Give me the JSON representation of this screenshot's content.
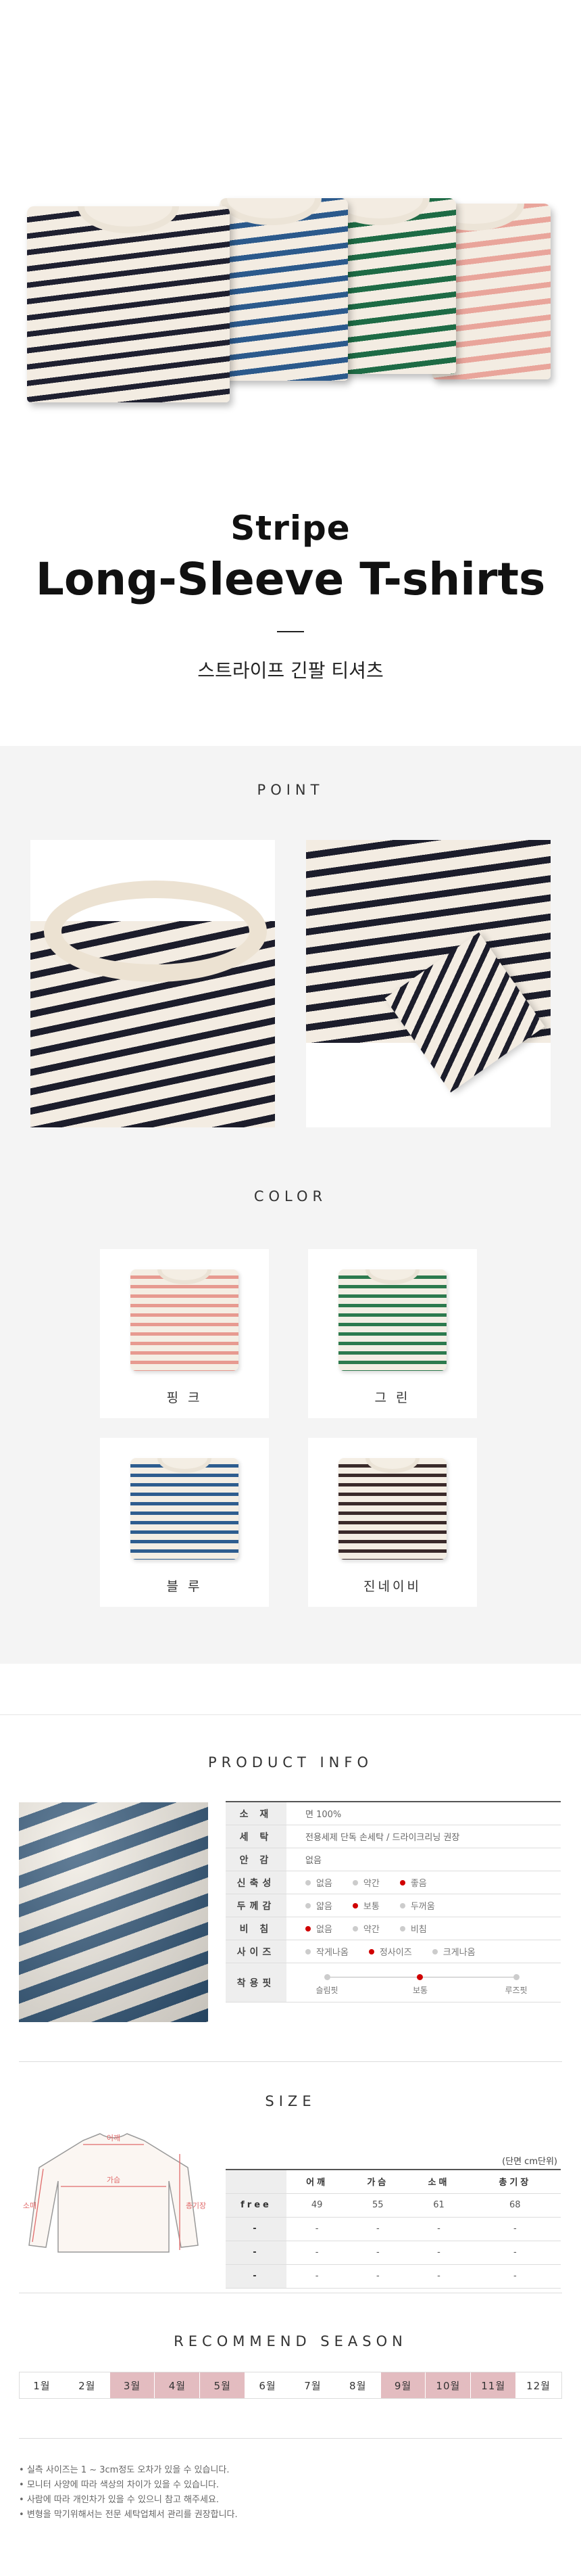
{
  "hero": {
    "title_line1": "Stripe",
    "title_line2": "Long-Sleeve T-shirts",
    "subtitle_ko": "스트라이프 긴팔 티셔츠",
    "shirt_colors": [
      "#1f2030",
      "#2c5a8c",
      "#1e6b45",
      "#e9a59b"
    ]
  },
  "point": {
    "title": "POINT"
  },
  "color": {
    "title": "COLOR",
    "items": [
      {
        "label": "핑 크",
        "stripe": "#e79a90"
      },
      {
        "label": "그 린",
        "stripe": "#2d7a4e"
      },
      {
        "label": "블 루",
        "stripe": "#2e5d8f"
      },
      {
        "label": "진네이비",
        "stripe": "#3a2a2a"
      }
    ]
  },
  "product_info": {
    "title": "PRODUCT INFO",
    "rows": [
      {
        "key": "소 재",
        "value": "면 100%"
      },
      {
        "key": "세 탁",
        "value": "전용세제 단독 손세탁 / 드라이크리닝 권장"
      },
      {
        "key": "안 감",
        "value": "없음"
      },
      {
        "key": "신축성",
        "options": [
          "없음",
          "약간",
          "좋음"
        ],
        "selected": 2
      },
      {
        "key": "두께감",
        "options": [
          "얇음",
          "보통",
          "두꺼움"
        ],
        "selected": 1
      },
      {
        "key": "비 침",
        "options": [
          "없음",
          "약간",
          "비침"
        ],
        "selected": 0
      },
      {
        "key": "사이즈",
        "options": [
          "작게나옴",
          "정사이즈",
          "크게나옴"
        ],
        "selected": 1
      },
      {
        "key": "착용핏",
        "fit": [
          "슬림핏",
          "보통",
          "루즈핏"
        ],
        "selected": 1
      }
    ]
  },
  "size": {
    "title": "SIZE",
    "unit": "(단면 cm단위)",
    "diagram_labels": {
      "shoulder": "어깨",
      "chest": "가슴",
      "sleeve": "소매",
      "length": "총기장"
    },
    "headers": [
      "",
      "어깨",
      "가슴",
      "소매",
      "총기장"
    ],
    "rows": [
      [
        "free",
        "49",
        "55",
        "61",
        "68"
      ],
      [
        "-",
        "-",
        "-",
        "-",
        "-"
      ],
      [
        "-",
        "-",
        "-",
        "-",
        "-"
      ],
      [
        "-",
        "-",
        "-",
        "-",
        "-"
      ]
    ]
  },
  "season": {
    "title": "RECOMMEND SEASON",
    "months": [
      "1월",
      "2월",
      "3월",
      "4월",
      "5월",
      "6월",
      "7월",
      "8월",
      "9월",
      "10월",
      "11월",
      "12월"
    ],
    "active": [
      3,
      4,
      5,
      9,
      10,
      11
    ],
    "highlight_color": "#e3bcc0"
  },
  "notes": [
    "실측 사이즈는 1 ~ 3cm정도 오차가 있을 수 있습니다.",
    "모니터 사양에 따라 색상의 차이가 있을 수 있습니다.",
    "사람에 따라 개인차가 있을 수 있으니 참고 해주세요.",
    "변형을 막기위해서는 전문 세탁업체서 관리를 권장합니다."
  ]
}
